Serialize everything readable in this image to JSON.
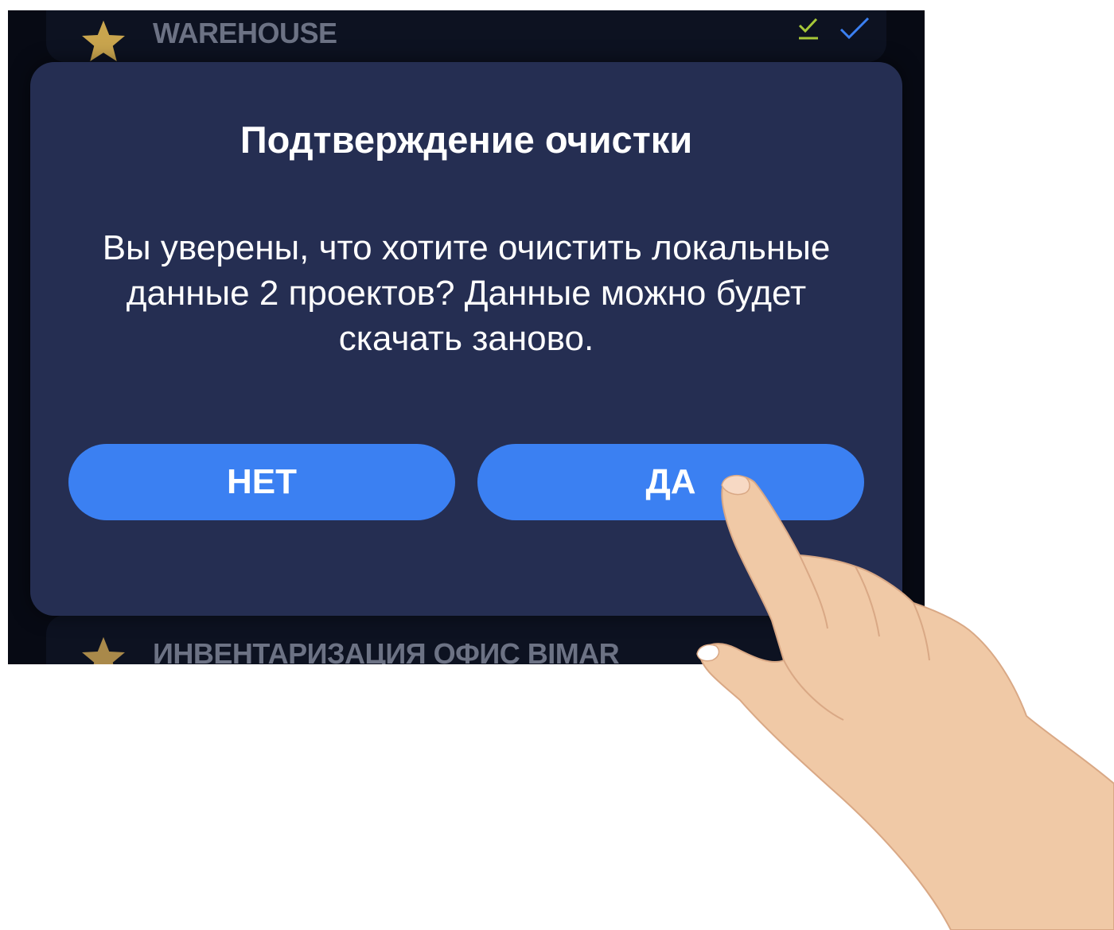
{
  "list": {
    "items": [
      {
        "title": "WAREHOUSE",
        "icon": "star-icon"
      },
      {
        "title": "ИНВЕНТАРИЗАЦИЯ ОФИС BIMAR",
        "icon": "star-icon"
      }
    ]
  },
  "dialog": {
    "title": "Подтверждение очистки",
    "message": "Вы уверены, что хотите очистить локальные данные 2 проектов? Данные можно будет скачать заново.",
    "buttons": {
      "no": "НЕТ",
      "yes": "ДА"
    }
  },
  "colors": {
    "background": "#070a14",
    "dialog": "#252e52",
    "button": "#3b80f2",
    "star": "#c9a54e",
    "download_check": "#a7c838",
    "sync_check": "#3b80f2"
  }
}
